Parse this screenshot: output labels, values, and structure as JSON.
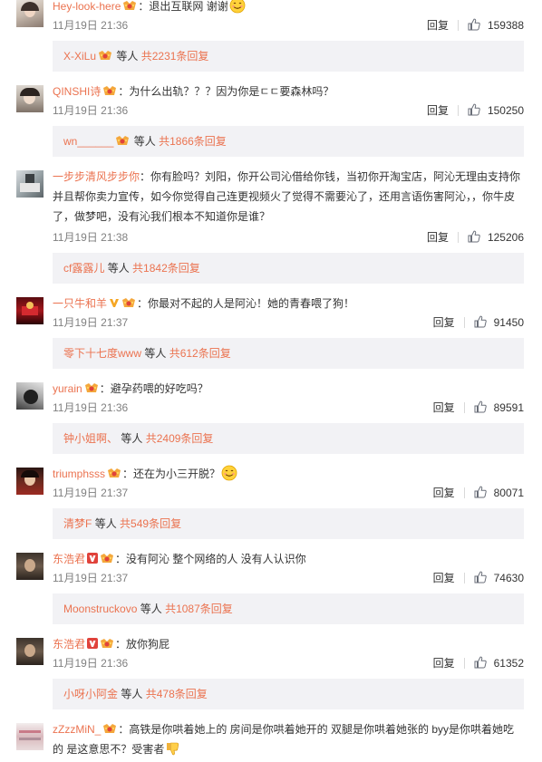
{
  "labels": {
    "reply": "回复",
    "replies_suffix": "等人"
  },
  "colors": {
    "link": "#eb7350",
    "time": "#808080",
    "reply_bg": "#f2f2f5"
  },
  "comments": [
    {
      "user": "Hey-look-here",
      "badges": [
        "vip"
      ],
      "text": "：退出互联网 谢谢",
      "emoji_after": "smile",
      "time": "11月19日 21:36",
      "likes": "159388",
      "reply_user": "X-XiLu",
      "reply_badges": [
        "vip"
      ],
      "reply_total": "共2231条回复"
    },
    {
      "user": "QINSHI诗",
      "badges": [
        "vip"
      ],
      "text": "：为什么出轨？？？因为你是ㄷㄷ要森林吗？",
      "time": "11月19日 21:36",
      "likes": "150250",
      "reply_user": "wn______",
      "reply_badges": [
        "vip"
      ],
      "reply_total": "共1866条回复"
    },
    {
      "user": "一步步清风步步你",
      "badges": [],
      "text": "：你有脸吗？刘阳，你开公司沁借给你钱，当初你开淘宝店，阿沁无理由支持你并且帮你卖力宣传，如今你觉得自己连更视频火了觉得不需要沁了，还用言语伤害阿沁，，你牛皮了，做梦吧，没有沁我们根本不知道你是谁？",
      "time": "11月19日 21:38",
      "likes": "125206",
      "reply_user": "cf露露儿",
      "reply_badges": [],
      "reply_total": "共1842条回复"
    },
    {
      "user": "一只牛和羊",
      "badges": [
        "v-gold",
        "vip"
      ],
      "text": "：你最对不起的人是阿沁！她的青春喂了狗！",
      "time": "11月19日 21:37",
      "likes": "91450",
      "reply_user": "零下十七度www",
      "reply_badges": [],
      "reply_total": "共612条回复"
    },
    {
      "user": "yurain",
      "badges": [
        "vip"
      ],
      "text": "：避孕药喂的好吃吗？",
      "time": "11月19日 21:36",
      "likes": "89591",
      "reply_user": "钟小姐啊、",
      "reply_badges": [],
      "reply_total": "共2409条回复"
    },
    {
      "user": "triumphsss",
      "badges": [
        "vip"
      ],
      "text": "：还在为小三开脱？",
      "emoji_after": "smile",
      "time": "11月19日 21:37",
      "likes": "80071",
      "reply_user": "清梦F",
      "reply_badges": [],
      "reply_total": "共549条回复"
    },
    {
      "user": "东浩君",
      "badges": [
        "v-red",
        "vip"
      ],
      "text": "：没有阿沁 整个网络的人 没有人认识你",
      "time": "11月19日 21:37",
      "likes": "74630",
      "reply_user": "Moonstruckovo",
      "reply_badges": [],
      "reply_total": "共1087条回复"
    },
    {
      "user": "东浩君",
      "badges": [
        "v-red",
        "vip"
      ],
      "text": "：放你狗屁",
      "time": "11月19日 21:36",
      "likes": "61352",
      "reply_user": "小呀小阿金",
      "reply_badges": [],
      "reply_total": "共478条回复"
    },
    {
      "user": "zZzzMiN_",
      "badges": [
        "vip"
      ],
      "text": "：高铁是你哄着她上的 房间是你哄着她开的 双腿是你哄着她张的 byy是你哄着她吃的 是这意思不？受害者",
      "emoji_after": "thumbdown"
    }
  ]
}
